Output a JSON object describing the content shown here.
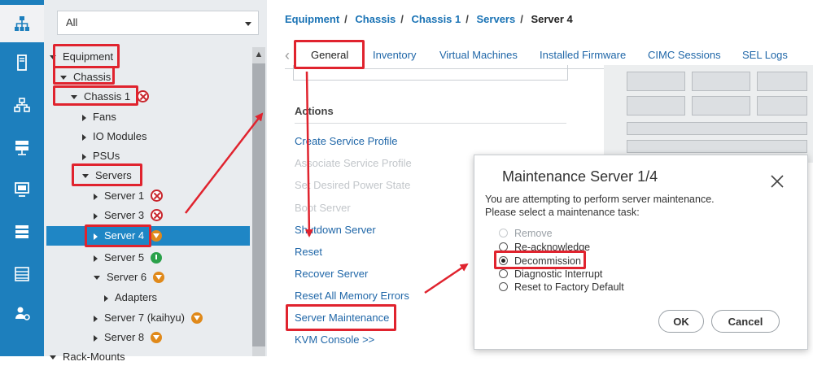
{
  "rail": {
    "icons": [
      "network-icon",
      "server-icon",
      "lan-icon",
      "storage-icon",
      "vm-icon",
      "chassis-icon",
      "admin-icon",
      "user-settings-icon"
    ]
  },
  "tree": {
    "filter_value": "All",
    "nodes": [
      {
        "label": "Equipment"
      },
      {
        "label": "Chassis"
      },
      {
        "label": "Chassis 1"
      },
      {
        "label": "Fans"
      },
      {
        "label": "IO Modules"
      },
      {
        "label": "PSUs"
      },
      {
        "label": "Servers"
      },
      {
        "label": "Server 1"
      },
      {
        "label": "Server 3"
      },
      {
        "label": "Server 4"
      },
      {
        "label": "Server 5"
      },
      {
        "label": "Server 6"
      },
      {
        "label": "Adapters"
      },
      {
        "label": "Server 7 (kaihyu)"
      },
      {
        "label": "Server 8"
      },
      {
        "label": "Rack-Mounts"
      }
    ]
  },
  "breadcrumb": [
    "Equipment",
    "Chassis",
    "Chassis 1",
    "Servers",
    "Server 4"
  ],
  "tabs": [
    "General",
    "Inventory",
    "Virtual Machines",
    "Installed Firmware",
    "CIMC Sessions",
    "SEL Logs"
  ],
  "actions": {
    "title": "Actions",
    "items": [
      "Create Service Profile",
      "Associate Service Profile",
      "Set Desired Power State",
      "Boot Server",
      "Shutdown Server",
      "Reset",
      "Recover Server",
      "Reset All Memory Errors",
      "Server Maintenance",
      "KVM Console >>"
    ]
  },
  "modal": {
    "title": "Maintenance Server 1/4",
    "message_line1": "You are attempting to perform server maintenance.",
    "message_line2": "Please select a maintenance task:",
    "options": [
      "Remove",
      "Re-acknowledge",
      "Decommission",
      "Diagnostic Interrupt",
      "Reset to Factory Default"
    ],
    "selected": "Decommission",
    "ok_label": "OK",
    "cancel_label": "Cancel"
  },
  "colors": {
    "accent": "#1d7fbd",
    "selection": "#1f86c5",
    "critical": "#c8252c",
    "warning": "#e0891a",
    "ok": "#2aa14a",
    "annotation": "#e0232e"
  }
}
